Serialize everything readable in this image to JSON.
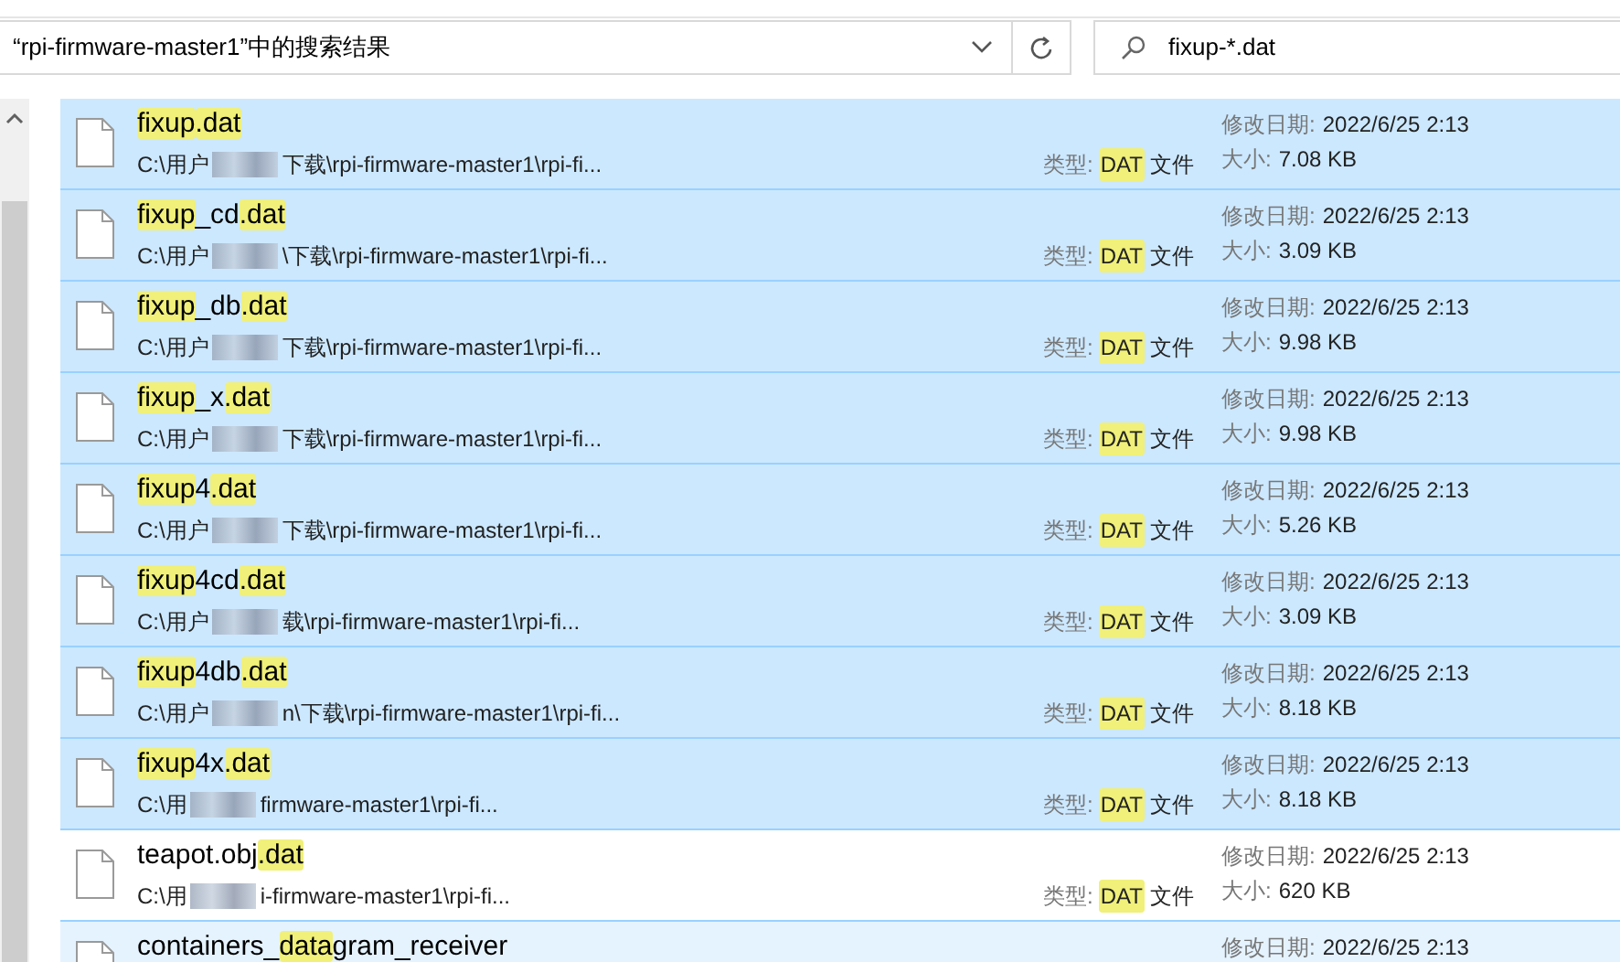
{
  "address": {
    "value": "“rpi-firmware-master1”中的搜索结果"
  },
  "search": {
    "value": "fixup-*.dat"
  },
  "results": [
    {
      "name": [
        {
          "text": "fixup",
          "highlight": true
        },
        {
          "text": ".dat",
          "highlight": true
        }
      ],
      "path_start": "C:\\用户",
      "path_end": "下载\\rpi-firmware-master1\\rpi-fi...",
      "type_label": "类型:",
      "type_value": "DAT",
      "type_suffix": "文件",
      "date_label": "修改日期:",
      "date": "2022/6/25 2:13",
      "size_label": "大小:",
      "size": "7.08 KB",
      "selected": true
    },
    {
      "name": [
        {
          "text": "fixup",
          "highlight": true
        },
        {
          "text": "_cd",
          "highlight": false
        },
        {
          "text": ".dat",
          "highlight": true
        }
      ],
      "path_start": "C:\\用户",
      "path_end": "\\下载\\rpi-firmware-master1\\rpi-fi...",
      "type_label": "类型:",
      "type_value": "DAT",
      "type_suffix": "文件",
      "date_label": "修改日期:",
      "date": "2022/6/25 2:13",
      "size_label": "大小:",
      "size": "3.09 KB",
      "selected": true
    },
    {
      "name": [
        {
          "text": "fixup",
          "highlight": true
        },
        {
          "text": "_db",
          "highlight": false
        },
        {
          "text": ".dat",
          "highlight": true
        }
      ],
      "path_start": "C:\\用户",
      "path_end": "下载\\rpi-firmware-master1\\rpi-fi...",
      "type_label": "类型:",
      "type_value": "DAT",
      "type_suffix": "文件",
      "date_label": "修改日期:",
      "date": "2022/6/25 2:13",
      "size_label": "大小:",
      "size": "9.98 KB",
      "selected": true
    },
    {
      "name": [
        {
          "text": "fixup",
          "highlight": true
        },
        {
          "text": "_x",
          "highlight": false
        },
        {
          "text": ".dat",
          "highlight": true
        }
      ],
      "path_start": "C:\\用户",
      "path_end": "下载\\rpi-firmware-master1\\rpi-fi...",
      "type_label": "类型:",
      "type_value": "DAT",
      "type_suffix": "文件",
      "date_label": "修改日期:",
      "date": "2022/6/25 2:13",
      "size_label": "大小:",
      "size": "9.98 KB",
      "selected": true
    },
    {
      "name": [
        {
          "text": "fixup",
          "highlight": true
        },
        {
          "text": "4",
          "highlight": false
        },
        {
          "text": ".dat",
          "highlight": true
        }
      ],
      "path_start": "C:\\用户",
      "path_end": "下载\\rpi-firmware-master1\\rpi-fi...",
      "type_label": "类型:",
      "type_value": "DAT",
      "type_suffix": "文件",
      "date_label": "修改日期:",
      "date": "2022/6/25 2:13",
      "size_label": "大小:",
      "size": "5.26 KB",
      "selected": true
    },
    {
      "name": [
        {
          "text": "fixup",
          "highlight": true
        },
        {
          "text": "4cd",
          "highlight": false
        },
        {
          "text": ".dat",
          "highlight": true
        }
      ],
      "path_start": "C:\\用户",
      "path_end": "载\\rpi-firmware-master1\\rpi-fi...",
      "type_label": "类型:",
      "type_value": "DAT",
      "type_suffix": "文件",
      "date_label": "修改日期:",
      "date": "2022/6/25 2:13",
      "size_label": "大小:",
      "size": "3.09 KB",
      "selected": true
    },
    {
      "name": [
        {
          "text": "fixup",
          "highlight": true
        },
        {
          "text": "4db",
          "highlight": false
        },
        {
          "text": ".dat",
          "highlight": true
        }
      ],
      "path_start": "C:\\用户",
      "path_end": "n\\下载\\rpi-firmware-master1\\rpi-fi...",
      "type_label": "类型:",
      "type_value": "DAT",
      "type_suffix": "文件",
      "date_label": "修改日期:",
      "date": "2022/6/25 2:13",
      "size_label": "大小:",
      "size": "8.18 KB",
      "selected": true
    },
    {
      "name": [
        {
          "text": "fixup",
          "highlight": true
        },
        {
          "text": "4x",
          "highlight": false
        },
        {
          "text": ".dat",
          "highlight": true
        }
      ],
      "path_start": "C:\\用",
      "path_end": "firmware-master1\\rpi-fi...",
      "type_label": "类型:",
      "type_value": "DAT",
      "type_suffix": "文件",
      "date_label": "修改日期:",
      "date": "2022/6/25 2:13",
      "size_label": "大小:",
      "size": "8.18 KB",
      "selected": true
    },
    {
      "name": [
        {
          "text": "teapot.obj",
          "highlight": false
        },
        {
          "text": ".dat",
          "highlight": true
        }
      ],
      "path_start": "C:\\用",
      "path_end": "i-firmware-master1\\rpi-fi...",
      "type_label": "类型:",
      "type_value": "DAT",
      "type_suffix": "文件",
      "date_label": "修改日期:",
      "date": "2022/6/25 2:13",
      "size_label": "大小:",
      "size": "620 KB",
      "selected": false
    },
    {
      "name": [
        {
          "text": "containers_",
          "highlight": false
        },
        {
          "text": "data",
          "highlight": true
        },
        {
          "text": "gram_receiver",
          "highlight": false
        }
      ],
      "date_label": "修改日期:",
      "date": "2022/6/25 2:13",
      "selected": false,
      "hovered": true
    }
  ]
}
